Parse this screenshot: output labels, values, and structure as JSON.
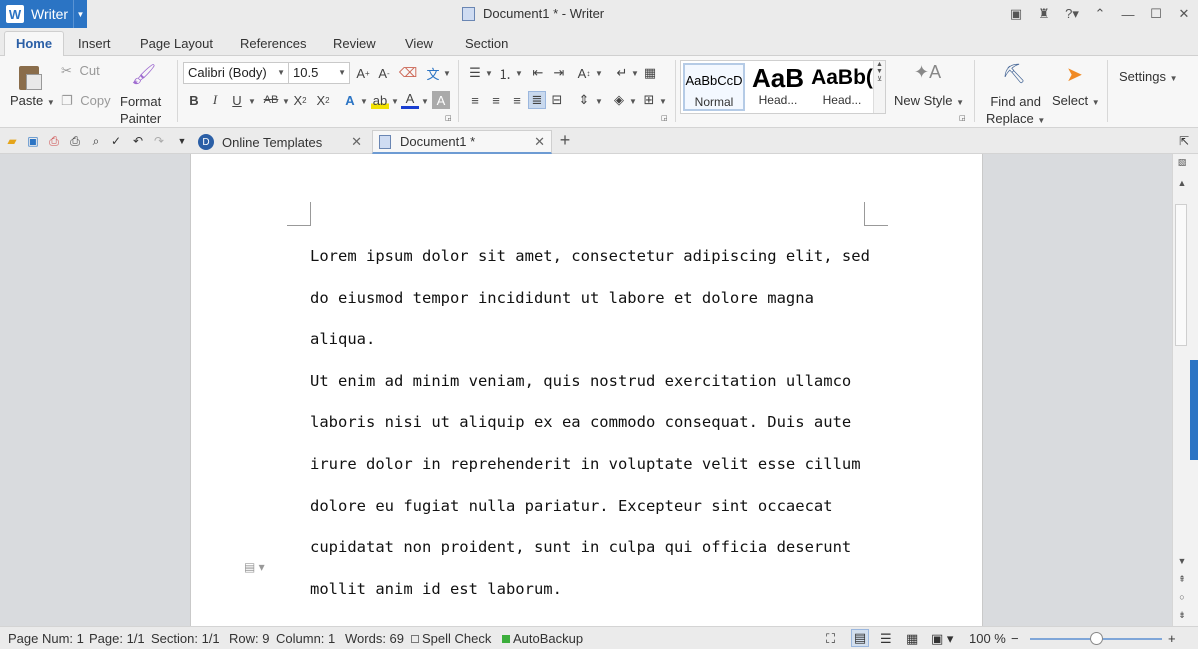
{
  "app": {
    "name": "Writer",
    "logo_letter": "W",
    "accent": "#2b74c4"
  },
  "window": {
    "title": "Document1 * - Writer"
  },
  "menu_tabs": [
    "Home",
    "Insert",
    "Page Layout",
    "References",
    "Review",
    "View",
    "Section"
  ],
  "ribbon": {
    "paste": "Paste",
    "cut": "Cut",
    "copy": "Copy",
    "format_painter_1": "Format",
    "format_painter_2": "Painter",
    "font_name": "Calibri (Body)",
    "font_size": "10.5",
    "styles": [
      {
        "sample": "AaBbCcD",
        "label": "Normal"
      },
      {
        "sample": "AaB",
        "label": "Head..."
      },
      {
        "sample": "AaBb(",
        "label": "Head..."
      }
    ],
    "new_style": "New Style",
    "find_replace_1": "Find and",
    "find_replace_2": "Replace",
    "select": "Select",
    "settings": "Settings"
  },
  "doc_tabs": [
    {
      "label": "Online Templates"
    },
    {
      "label": "Document1 *"
    }
  ],
  "document": {
    "lines": [
      "Lorem ipsum dolor sit amet, consectetur adipiscing elit, sed",
      "do eiusmod tempor incididunt ut labore et dolore magna aliqua.",
      "Ut enim ad minim veniam, quis nostrud exercitation ullamco",
      "laboris nisi ut aliquip ex ea commodo consequat. Duis aute",
      "irure dolor in reprehenderit in voluptate velit esse cillum",
      "dolore eu fugiat nulla pariatur. Excepteur sint occaecat",
      "cupidatat non proident, sunt in culpa qui officia deserunt",
      "mollit anim id est laborum."
    ]
  },
  "status": {
    "page_num": "Page Num: 1",
    "page": "Page: 1/1",
    "section": "Section: 1/1",
    "row": "Row: 9",
    "column": "Column: 1",
    "words": "Words: 69",
    "spell_check": "Spell Check",
    "autobackup": "AutoBackup",
    "zoom": "100 %"
  }
}
